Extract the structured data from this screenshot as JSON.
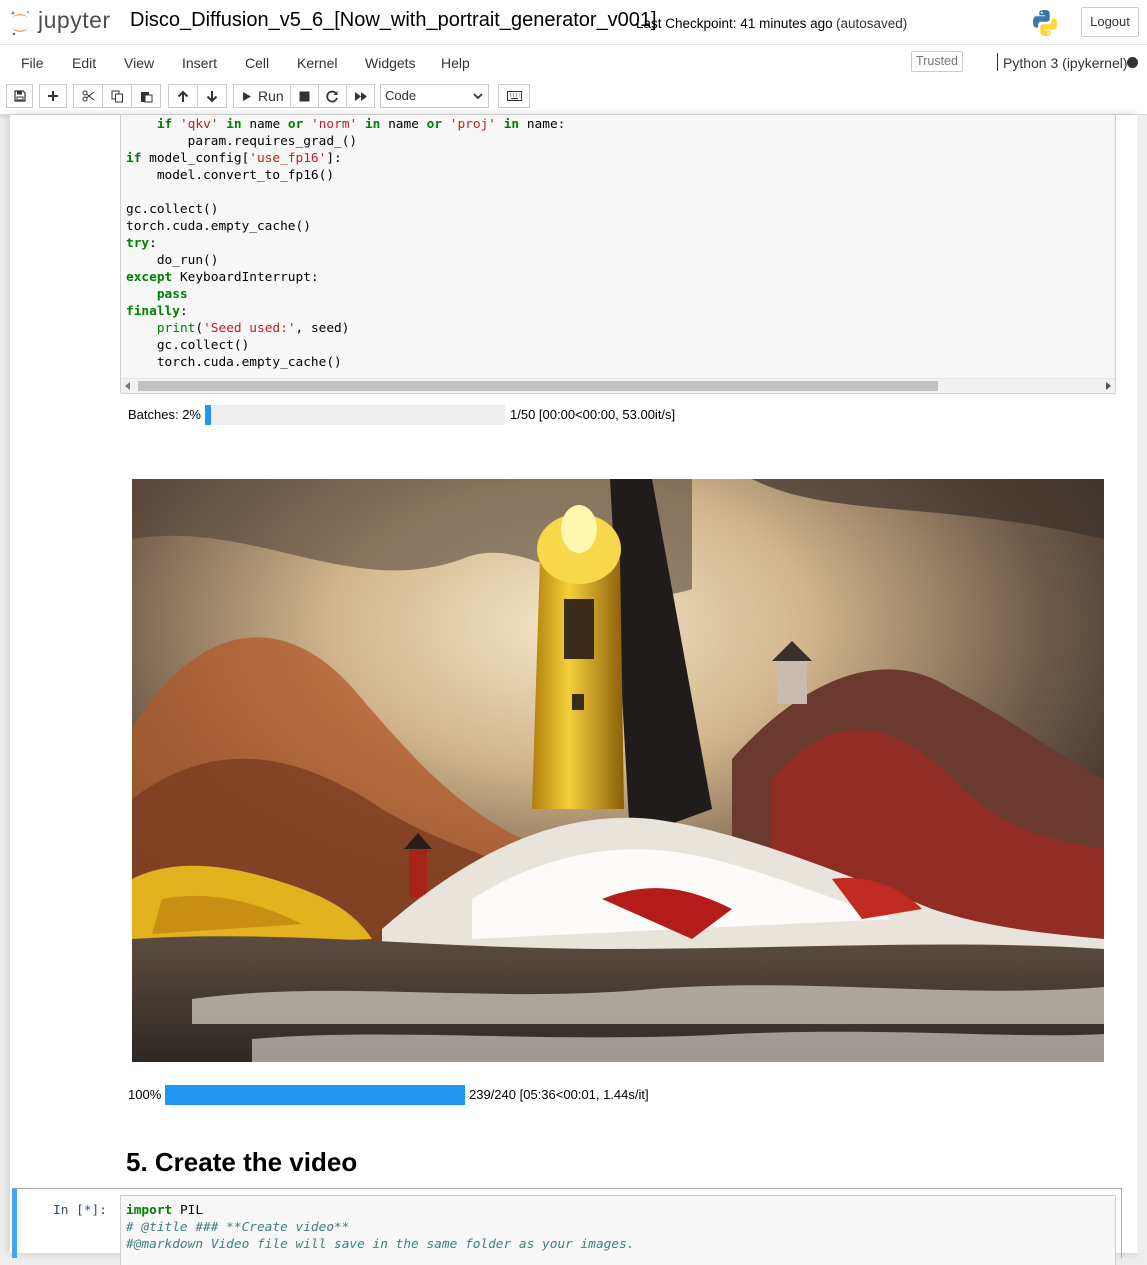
{
  "header": {
    "logo_text": "jupyter",
    "notebook_title": "Disco_Diffusion_v5_6_[Now_with_portrait_generator_v001]",
    "checkpoint": "Last Checkpoint: 41 minutes ago",
    "autosave_status": "(autosaved)",
    "logout_label": "Logout"
  },
  "menubar": {
    "items": [
      "File",
      "Edit",
      "View",
      "Insert",
      "Cell",
      "Kernel",
      "Widgets",
      "Help"
    ],
    "trusted_label": "Trusted",
    "kernel_name": "Python 3 (ipykernel)"
  },
  "toolbar": {
    "run_label": "Run",
    "cell_type": "Code",
    "buttons": [
      "save-icon",
      "plus-icon",
      "cut-icon",
      "copy-icon",
      "paste-icon",
      "arrow-up-icon",
      "arrow-down-icon",
      "run-icon",
      "stop-icon",
      "restart-icon",
      "fast-forward-icon",
      "keyboard-icon"
    ]
  },
  "cell_1": {
    "code_lines": [
      "    if 'qkv' in name or 'norm' in name or 'proj' in name:",
      "        param.requires_grad_()",
      "if model_config['use_fp16']:",
      "    model.convert_to_fp16()",
      "",
      "gc.collect()",
      "torch.cuda.empty_cache()",
      "try:",
      "    do_run()",
      "except KeyboardInterrupt:",
      "    pass",
      "finally:",
      "    print('Seed used:', seed)",
      "    gc.collect()",
      "    torch.cuda.empty_cache()"
    ]
  },
  "outputs": {
    "batches_label": "Batches: 2%",
    "batches_fraction": 0.02,
    "batches_info": "1/50 [00:00<00:00, 53.00it/s]",
    "steps_label": "100%",
    "steps_fraction": 1.0,
    "steps_info": "239/240 [05:36<00:01, 1.44s/it]",
    "progress_color": "#2196f3"
  },
  "section_heading": "5. Create the video",
  "cell_2": {
    "prompt": "In [*]:",
    "code_lines": [
      "import PIL",
      "# @title ### **Create video**",
      "#@markdown Video file will save in the same folder as your images."
    ]
  },
  "colors": {
    "accent_blue": "#42a5f5",
    "jupyter_orange": "#f37726"
  }
}
